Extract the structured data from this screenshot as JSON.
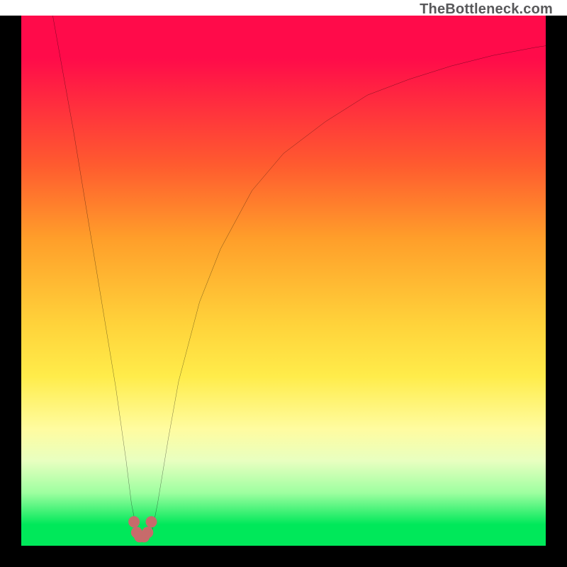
{
  "attribution": "TheBottleneck.com",
  "chart_data": {
    "type": "line",
    "title": "",
    "xlabel": "",
    "ylabel": "",
    "xlim": [
      0,
      100
    ],
    "ylim": [
      0,
      100
    ],
    "curve": {
      "name": "bottleneck-curve",
      "x": [
        6,
        8,
        10,
        12,
        14,
        16,
        18,
        20,
        21,
        22,
        23,
        24,
        25,
        26,
        28,
        30,
        34,
        38,
        44,
        50,
        58,
        66,
        74,
        82,
        90,
        98,
        100
      ],
      "y": [
        100,
        89,
        78,
        66,
        54,
        42,
        30,
        16,
        8,
        3,
        1.5,
        1.5,
        3,
        8,
        20,
        31,
        46,
        56,
        67,
        74,
        80,
        85,
        88,
        90.5,
        92.5,
        94,
        94.3
      ]
    },
    "markers": {
      "name": "trough-points",
      "color": "#c76b6b",
      "points": [
        {
          "x": 21.5,
          "y": 4.5
        },
        {
          "x": 22.0,
          "y": 2.5
        },
        {
          "x": 22.6,
          "y": 1.7
        },
        {
          "x": 23.4,
          "y": 1.7
        },
        {
          "x": 24.1,
          "y": 2.5
        },
        {
          "x": 24.8,
          "y": 4.5
        }
      ]
    },
    "gradient_stops": [
      {
        "pct": 0,
        "color": "#ff0b4a"
      },
      {
        "pct": 28,
        "color": "#ff5a2f"
      },
      {
        "pct": 58,
        "color": "#ffd23a"
      },
      {
        "pct": 78,
        "color": "#fffca0"
      },
      {
        "pct": 96,
        "color": "#00e85a"
      }
    ]
  }
}
